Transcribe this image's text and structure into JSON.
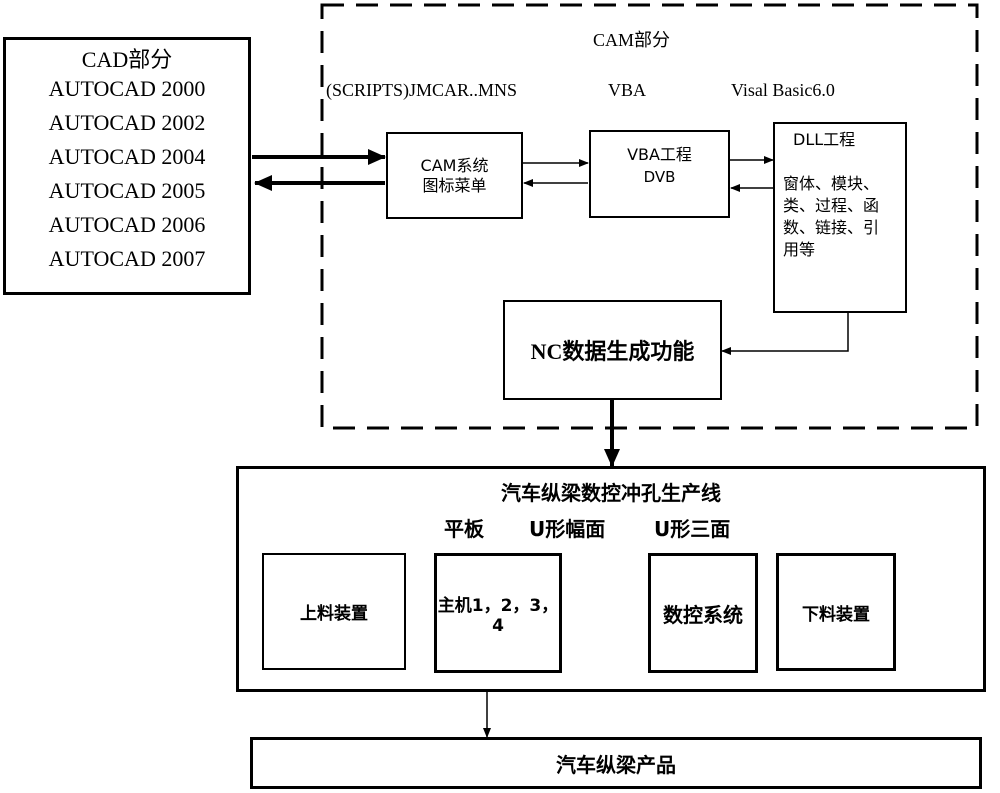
{
  "cad_section": {
    "title": "CAD部分",
    "versions": [
      "AUTOCAD 2000",
      "AUTOCAD 2002",
      "AUTOCAD 2004",
      "AUTOCAD 2005",
      "AUTOCAD 2006",
      "AUTOCAD 2007"
    ]
  },
  "cam_section": {
    "title": "CAM部分",
    "labels": [
      "(SCRIPTS)JMCAR..MNS",
      "VBA",
      "Visal Basic6.0"
    ],
    "cam_menu": {
      "line1": "CAM系统",
      "line2": "图标菜单"
    },
    "vba_project": {
      "line1": "VBA工程",
      "line2": "DVB"
    },
    "dll_project": {
      "title": "DLL工程",
      "lines": [
        "窗体、模块、",
        "类、过程、函",
        "数、链接、引",
        "用等"
      ]
    },
    "nc_function": "NC数据生成功能"
  },
  "production_line": {
    "title": "汽车纵梁数控冲孔生产线",
    "types": [
      "平板",
      "U形幅面",
      "U形三面"
    ],
    "units": [
      "上料装置",
      "主机1，2，3，4",
      "数控系统",
      "下料装置"
    ]
  },
  "product": "汽车纵梁产品"
}
